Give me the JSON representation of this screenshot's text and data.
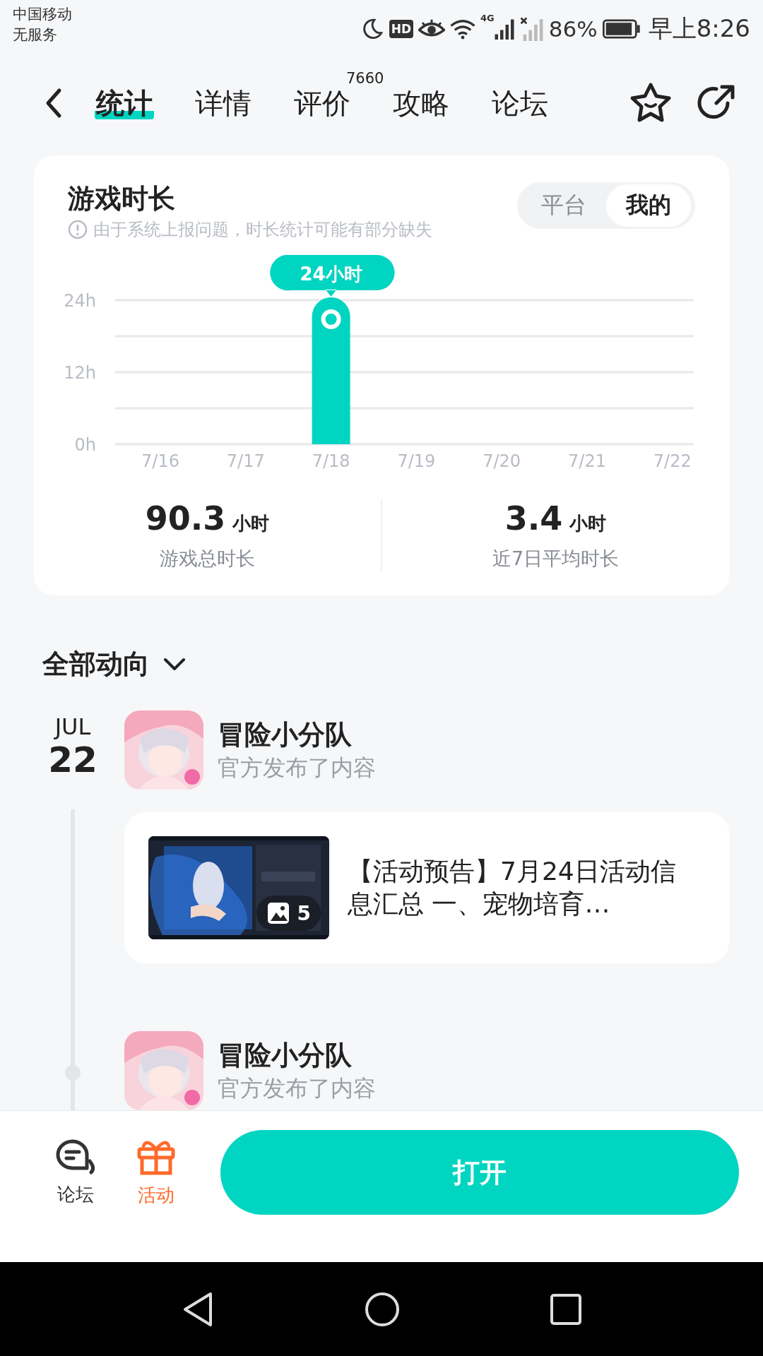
{
  "status_bar": {
    "carrier": "中国移动",
    "service": "无服务",
    "hd": "HD",
    "network": "4G",
    "battery": "86%",
    "time": "早上8:26"
  },
  "tabs": [
    {
      "label": "统计",
      "selected": true
    },
    {
      "label": "详情",
      "selected": false
    },
    {
      "label": "评价",
      "selected": false,
      "badge": "7660"
    },
    {
      "label": "攻略",
      "selected": false
    },
    {
      "label": "论坛",
      "selected": false
    }
  ],
  "card": {
    "title": "游戏时长",
    "notice": "由于系统上报问题，时长统计可能有部分缺失",
    "toggle": [
      {
        "label": "平台",
        "selected": false
      },
      {
        "label": "我的",
        "selected": true
      }
    ],
    "chart_data": {
      "type": "bar",
      "categories": [
        "7/16",
        "7/17",
        "7/18",
        "7/19",
        "7/20",
        "7/21",
        "7/22"
      ],
      "values": [
        0,
        0,
        24,
        0,
        0,
        0,
        0
      ],
      "ylim": [
        0,
        24
      ],
      "yticks": [
        {
          "value": 0,
          "label": "0h"
        },
        {
          "value": 12,
          "label": "12h"
        },
        {
          "value": 24,
          "label": "24h"
        }
      ],
      "annotations": [
        {
          "x": "7/18",
          "y": 24,
          "text": "24小时"
        }
      ]
    },
    "stats": [
      {
        "value": "90.3",
        "unit": "小时",
        "label": "游戏总时长"
      },
      {
        "value": "3.4",
        "unit": "小时",
        "label": "近7日平均时长"
      }
    ]
  },
  "filter": "全部动向",
  "feed": [
    {
      "month": "JUL",
      "day": "22",
      "author": "冒险小分队",
      "action": "官方发布了内容",
      "post": {
        "text": "【活动预告】7月24日活动信息汇总 一、宠物培育…",
        "image_count": "5"
      }
    },
    {
      "author": "冒险小分队",
      "action": "官方发布了内容"
    }
  ],
  "bottom_bar": {
    "items": [
      {
        "kind": "chat",
        "label": "论坛",
        "selected": false
      },
      {
        "kind": "gift",
        "label": "活动",
        "selected": true
      }
    ],
    "open_button": "打开"
  }
}
